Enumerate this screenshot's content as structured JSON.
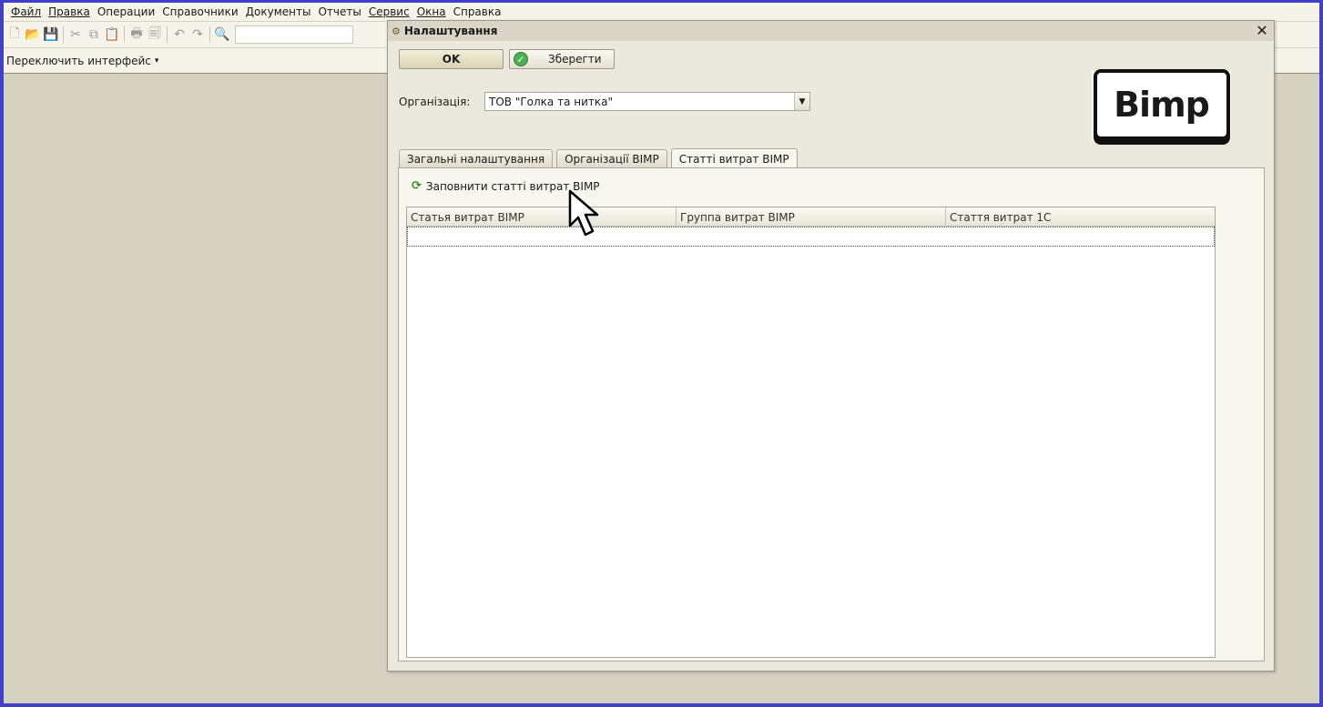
{
  "menu": [
    {
      "label": "Файл",
      "underline": true
    },
    {
      "label": "Правка",
      "underline": true
    },
    {
      "label": "Операции",
      "underline": false
    },
    {
      "label": "Справочники",
      "underline": false
    },
    {
      "label": "Документы",
      "underline": false
    },
    {
      "label": "Отчеты",
      "underline": false
    },
    {
      "label": "Сервис",
      "underline": true
    },
    {
      "label": "Окна",
      "underline": true
    },
    {
      "label": "Справка",
      "underline": false
    }
  ],
  "switchbar": {
    "label": "Переключить интерфейс"
  },
  "dialog": {
    "title": "Налаштування",
    "ok_label": "OK",
    "save_label": "Зберегти",
    "org_label": "Організація:",
    "org_value": "ТОВ \"Голка та нитка\"",
    "logo_text": "Bimp",
    "tabs": [
      {
        "label": "Загальні налаштування",
        "active": false
      },
      {
        "label": "Організації BIMP",
        "active": false
      },
      {
        "label": "Статті витрат BIMP",
        "active": true
      }
    ],
    "fill_link": "Заповнити статті витрат BIMP",
    "grid_columns": [
      "Статья витрат BIMP",
      "Группа витрат BIMP",
      "Стаття витрат 1С"
    ]
  }
}
